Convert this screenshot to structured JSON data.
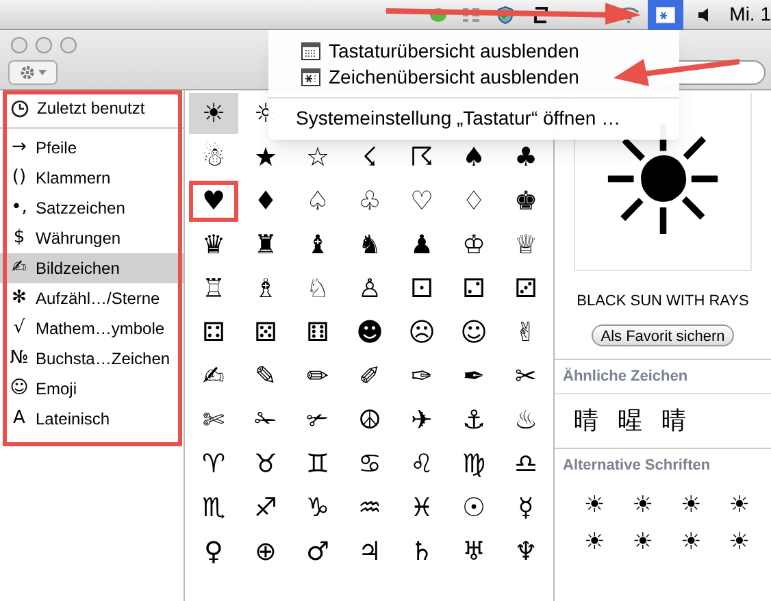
{
  "menu_bar": {
    "clock": "Mi. 1",
    "input_menu_open": true
  },
  "input_menu": {
    "sections": [
      [
        {
          "kind": "keyboard",
          "label": "Tastaturübersicht ausblenden"
        },
        {
          "kind": "characters",
          "label": "Zeichenübersicht ausblenden"
        }
      ],
      [
        {
          "kind": "text",
          "label": "Systemeinstellung „Tastatur“ öffnen …"
        }
      ]
    ]
  },
  "sidebar": {
    "annotated": true,
    "pinned": {
      "label": "Zuletzt benutzt",
      "selected": false
    },
    "items": [
      {
        "glyph": "→",
        "label": "Pfeile",
        "selected": false
      },
      {
        "glyph": "()",
        "label": "Klammern",
        "selected": false
      },
      {
        "glyph": "•,",
        "label": "Satzzeichen",
        "selected": false
      },
      {
        "glyph": "$",
        "label": "Währungen",
        "selected": false
      },
      {
        "glyph": "✍",
        "label": "Bildzeichen",
        "selected": true
      },
      {
        "glyph": "✻",
        "label": "Aufzähl…/Sterne",
        "selected": false
      },
      {
        "glyph": "√",
        "label": "Mathem…ymbole",
        "selected": false
      },
      {
        "glyph": "№",
        "label": "Buchsta…Zeichen",
        "selected": false
      },
      {
        "glyph": "☺",
        "label": "Emoji",
        "selected": false
      },
      {
        "glyph": "A",
        "label": "Lateinisch",
        "selected": false
      }
    ]
  },
  "grid": {
    "rows": [
      [
        {
          "char": "☀",
          "selected": true,
          "annotated": false
        },
        {
          "char": "☼",
          "selected": false,
          "annotated": false
        }
      ],
      [
        {
          "char": "☃",
          "selected": false,
          "annotated": false
        },
        {
          "char": "★",
          "selected": false,
          "annotated": false
        },
        {
          "char": "☆",
          "selected": false,
          "annotated": false
        },
        {
          "char": "☇",
          "selected": false,
          "annotated": false
        },
        {
          "char": "☈",
          "selected": false,
          "annotated": false
        },
        {
          "char": "♠",
          "selected": false,
          "annotated": false
        },
        {
          "char": "♣",
          "selected": false,
          "annotated": false
        }
      ],
      [
        {
          "char": "♥",
          "selected": false,
          "annotated": true
        },
        {
          "char": "♦",
          "selected": false,
          "annotated": false
        },
        {
          "char": "♤",
          "selected": false,
          "annotated": false
        },
        {
          "char": "♧",
          "selected": false,
          "annotated": false
        },
        {
          "char": "♡",
          "selected": false,
          "annotated": false
        },
        {
          "char": "♢",
          "selected": false,
          "annotated": false
        },
        {
          "char": "♚",
          "selected": false,
          "annotated": false
        }
      ],
      [
        {
          "char": "♛",
          "selected": false,
          "annotated": false
        },
        {
          "char": "♜",
          "selected": false,
          "annotated": false
        },
        {
          "char": "♝",
          "selected": false,
          "annotated": false
        },
        {
          "char": "♞",
          "selected": false,
          "annotated": false
        },
        {
          "char": "♟",
          "selected": false,
          "annotated": false
        },
        {
          "char": "♔",
          "selected": false,
          "annotated": false
        },
        {
          "char": "♕",
          "selected": false,
          "annotated": false
        }
      ],
      [
        {
          "char": "♖",
          "selected": false,
          "annotated": false
        },
        {
          "char": "♗",
          "selected": false,
          "annotated": false
        },
        {
          "char": "♘",
          "selected": false,
          "annotated": false
        },
        {
          "char": "♙",
          "selected": false,
          "annotated": false
        },
        {
          "char": "⚀",
          "selected": false,
          "annotated": false
        },
        {
          "char": "⚁",
          "selected": false,
          "annotated": false
        },
        {
          "char": "⚂",
          "selected": false,
          "annotated": false
        }
      ],
      [
        {
          "char": "⚃",
          "selected": false,
          "annotated": false
        },
        {
          "char": "⚄",
          "selected": false,
          "annotated": false
        },
        {
          "char": "⚅",
          "selected": false,
          "annotated": false
        },
        {
          "char": "☻",
          "selected": false,
          "annotated": false
        },
        {
          "char": "☹",
          "selected": false,
          "annotated": false
        },
        {
          "char": "☺",
          "selected": false,
          "annotated": false
        },
        {
          "char": "✌",
          "selected": false,
          "annotated": false
        }
      ],
      [
        {
          "char": "✍",
          "selected": false,
          "annotated": false
        },
        {
          "char": "✎",
          "selected": false,
          "annotated": false
        },
        {
          "char": "✏",
          "selected": false,
          "annotated": false
        },
        {
          "char": "✐",
          "selected": false,
          "annotated": false
        },
        {
          "char": "✑",
          "selected": false,
          "annotated": false
        },
        {
          "char": "✒",
          "selected": false,
          "annotated": false
        },
        {
          "char": "✂",
          "selected": false,
          "annotated": false
        }
      ],
      [
        {
          "char": "✄",
          "selected": false,
          "annotated": false
        },
        {
          "char": "✁",
          "selected": false,
          "annotated": false
        },
        {
          "char": "✃",
          "selected": false,
          "annotated": false
        },
        {
          "char": "☮",
          "selected": false,
          "annotated": false
        },
        {
          "char": "✈",
          "selected": false,
          "annotated": false
        },
        {
          "char": "⚓",
          "selected": false,
          "annotated": false
        },
        {
          "char": "♨",
          "selected": false,
          "annotated": false
        }
      ],
      [
        {
          "char": "♈",
          "selected": false,
          "annotated": false
        },
        {
          "char": "♉",
          "selected": false,
          "annotated": false
        },
        {
          "char": "♊",
          "selected": false,
          "annotated": false
        },
        {
          "char": "♋",
          "selected": false,
          "annotated": false
        },
        {
          "char": "♌",
          "selected": false,
          "annotated": false
        },
        {
          "char": "♍",
          "selected": false,
          "annotated": false
        },
        {
          "char": "♎",
          "selected": false,
          "annotated": false
        }
      ],
      [
        {
          "char": "♏",
          "selected": false,
          "annotated": false
        },
        {
          "char": "♐",
          "selected": false,
          "annotated": false
        },
        {
          "char": "♑",
          "selected": false,
          "annotated": false
        },
        {
          "char": "♒",
          "selected": false,
          "annotated": false
        },
        {
          "char": "♓",
          "selected": false,
          "annotated": false
        },
        {
          "char": "☉",
          "selected": false,
          "annotated": false
        },
        {
          "char": "☿",
          "selected": false,
          "annotated": false
        }
      ],
      [
        {
          "char": "♀",
          "selected": false,
          "annotated": false
        },
        {
          "char": "⊕",
          "selected": false,
          "annotated": false
        },
        {
          "char": "♂",
          "selected": false,
          "annotated": false
        },
        {
          "char": "♃",
          "selected": false,
          "annotated": false
        },
        {
          "char": "♄",
          "selected": false,
          "annotated": false
        },
        {
          "char": "♅",
          "selected": false,
          "annotated": false
        },
        {
          "char": "♆",
          "selected": false,
          "annotated": false
        }
      ]
    ]
  },
  "detail": {
    "preview": "☀",
    "name": "BLACK SUN WITH RAYS",
    "favorite_button": "Als Favorit sichern",
    "similar": {
      "title": "Ähnliche Zeichen",
      "chars": [
        "晴",
        "暒",
        "晴"
      ]
    },
    "alternatives": {
      "title": "Alternative Schriften",
      "chars": [
        "☀",
        "☀",
        "☀",
        "☀",
        "☀",
        "☀",
        "☀",
        "☀"
      ]
    }
  }
}
